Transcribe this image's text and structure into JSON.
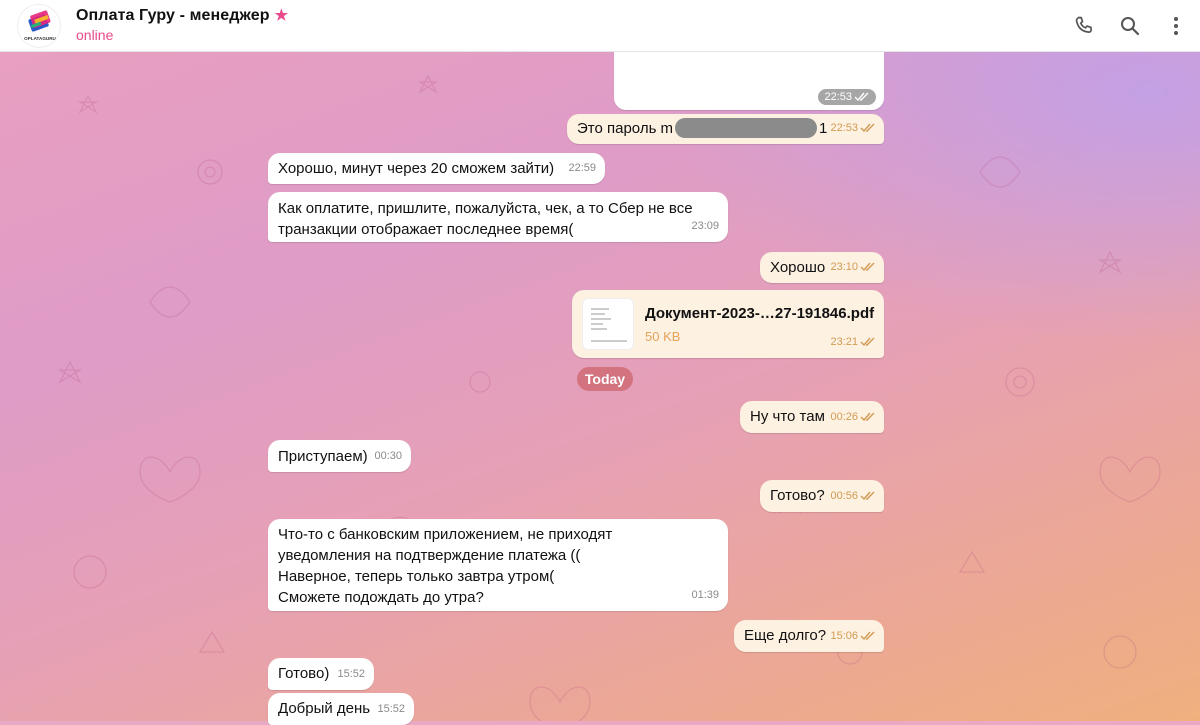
{
  "header": {
    "avatar_logo_text": "OPLATAGURU",
    "title": "Оплата Гуру - менеджер",
    "star": "★",
    "status": "online",
    "call_icon": "phone-icon",
    "search_icon": "search-icon",
    "menu_icon": "more-vertical-icon"
  },
  "colors": {
    "accent": "#e84a8c",
    "incoming_bubble": "#ffffff",
    "outgoing_bubble": "#fdf1e2",
    "outgoing_time": "#d19a52",
    "date_pill": "#d47380"
  },
  "messages": [
    {
      "id": "m0",
      "direction": "out",
      "type": "media",
      "time": "22:53",
      "status": "read"
    },
    {
      "id": "m1",
      "direction": "out",
      "text_before": "Это пароль m",
      "text_after": "1",
      "time": "22:53",
      "status": "read"
    },
    {
      "id": "m2",
      "direction": "in",
      "text": "Хорошо, минут через 20 сможем зайти)",
      "time": "22:59"
    },
    {
      "id": "m3",
      "direction": "in",
      "text": "Как оплатите, пришлите, пожалуйста, чек, а то Сбер не все\nтранзакции отображает последнее время(",
      "time": "23:09"
    },
    {
      "id": "m4",
      "direction": "out",
      "text": "Хорошо",
      "time": "23:10",
      "status": "read"
    },
    {
      "id": "m5",
      "direction": "out",
      "type": "document",
      "file_name": "Документ-2023-…27-191846.pdf",
      "file_size": "50 KB",
      "time": "23:21",
      "status": "read"
    },
    {
      "id": "m6",
      "direction": "out",
      "text": "Ну что там",
      "time": "00:26",
      "status": "read"
    },
    {
      "id": "m7",
      "direction": "in",
      "text": "Приступаем)",
      "time": "00:30"
    },
    {
      "id": "m8",
      "direction": "out",
      "text": "Готово?",
      "time": "00:56",
      "status": "read"
    },
    {
      "id": "m9",
      "direction": "in",
      "text": "Что-то с банковским приложением, не приходят\nуведомления на подтверждение платежа ((\nНаверное, теперь только завтра утром(\nСможете подождать до утра?",
      "time": "01:39"
    },
    {
      "id": "m10",
      "direction": "out",
      "text": "Еще долго?",
      "time": "15:06",
      "status": "read"
    },
    {
      "id": "m11",
      "direction": "in",
      "text": "Готово)",
      "time": "15:52"
    },
    {
      "id": "m12",
      "direction": "in",
      "text": "Добрый день",
      "time": "15:52"
    }
  ],
  "date_separator": "Today"
}
